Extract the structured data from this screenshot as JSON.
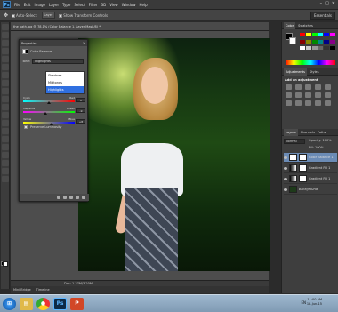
{
  "app": {
    "logo": "Ps",
    "window_controls": [
      "–",
      "□",
      "✕"
    ]
  },
  "menu": [
    "File",
    "Edit",
    "Image",
    "Layer",
    "Type",
    "Select",
    "Filter",
    "3D",
    "View",
    "Window",
    "Help"
  ],
  "options": {
    "auto_select": "Auto-Select:",
    "mode": "Layer",
    "show_transform": "Show Transform Controls",
    "workspace": "Essentials"
  },
  "document": {
    "tab_title": "the path.jpg @ 78.1% (Color Balance 1, Layer Mask/8) *",
    "status": "Doc: 1.37M/3.20M"
  },
  "bottom_tabs": [
    "Mini Bridge",
    "Timeline"
  ],
  "properties": {
    "tab": "Properties",
    "title": "Color Balance",
    "tone_label": "Tone:",
    "tone_value": "Highlights",
    "tone_options": [
      "Shadows",
      "Midtones",
      "Highlights"
    ],
    "tone_selected": 2,
    "sliders": [
      {
        "left": "Cyan",
        "right": "Red",
        "value": "0",
        "position": 0.5
      },
      {
        "left": "Magenta",
        "right": "Green",
        "value": "-9",
        "position": 0.43
      },
      {
        "left": "Yellow",
        "right": "Blue",
        "value": "+8",
        "position": 0.56
      }
    ],
    "preserve": "Preserve Luminosity"
  },
  "right_panels": {
    "color_tabs": [
      "Color",
      "Swatches"
    ],
    "adj_tabs": [
      "Adjustments",
      "Styles"
    ],
    "adj_label": "Add an adjustment",
    "layer_tabs": [
      "Layers",
      "Channels",
      "Paths"
    ],
    "blend_mode": "Normal",
    "opacity": "Opacity: 100%",
    "fill": "Fill: 100%",
    "layers": [
      {
        "name": "Color Balance 1",
        "selected": true
      },
      {
        "name": "Gradient Fill 1",
        "selected": false
      },
      {
        "name": "Gradient Fill 1",
        "selected": false
      },
      {
        "name": "Background",
        "selected": false
      }
    ]
  },
  "taskbar": {
    "time": "11:00 AM",
    "date": "18-Jun-15",
    "tray": "EN"
  },
  "colors": {
    "taskbar": "#8aa3bb",
    "selection": "#2f6fe0",
    "photoshop": "#0d2a45"
  }
}
